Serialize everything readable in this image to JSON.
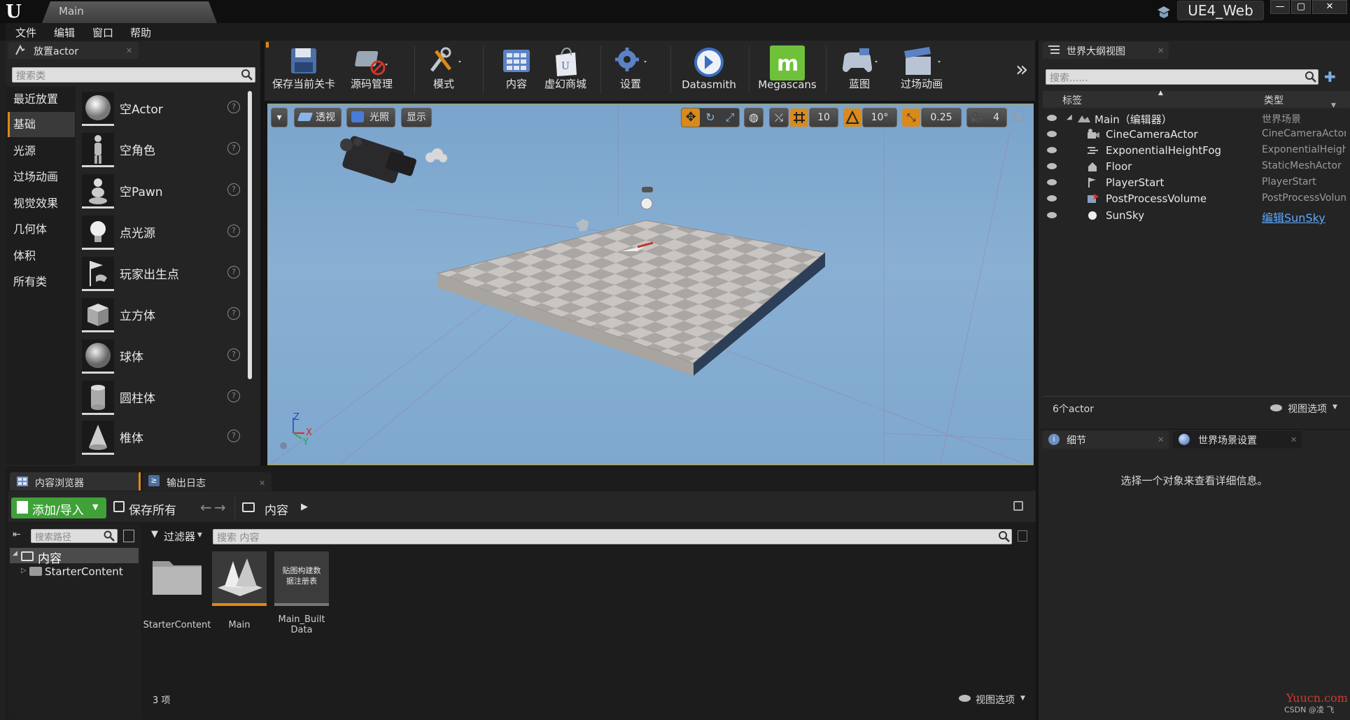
{
  "window": {
    "doc_tab": "Main",
    "project_name": "UE4_Web",
    "controls": [
      "—",
      "▢",
      "✕"
    ]
  },
  "menu": [
    "文件",
    "编辑",
    "窗口",
    "帮助"
  ],
  "place_actors": {
    "tab_title": "放置actor",
    "search_placeholder": "搜索类",
    "categories": [
      "最近放置",
      "基础",
      "光源",
      "过场动画",
      "视觉效果",
      "几何体",
      "体积",
      "所有类"
    ],
    "selected_category": "基础",
    "items": [
      "空Actor",
      "空角色",
      "空Pawn",
      "点光源",
      "玩家出生点",
      "立方体",
      "球体",
      "圆柱体",
      "椎体"
    ],
    "help_glyph": "?"
  },
  "toolbar": {
    "buttons": [
      "保存当前关卡",
      "源码管理",
      "模式",
      "内容",
      "虚幻商城",
      "设置",
      "Datasmith",
      "Megascans",
      "蓝图",
      "过场动画"
    ],
    "overflow": "»",
    "megascans_color": "#6fc13a"
  },
  "viewport": {
    "view_mode": "透视",
    "lighting": "光照",
    "show": "显示",
    "grid_snap": "10",
    "rotation_snap": "10°",
    "scale_snap": "0.25",
    "camera_speed": "4",
    "axis": {
      "z": "Z",
      "x": "X",
      "y": "Y"
    },
    "highlight_color": "#d98a1a"
  },
  "outliner": {
    "tab_title": "世界大纲视图",
    "search_placeholder": "搜索......",
    "col_label": "标签",
    "col_type": "类型",
    "root": {
      "name": "Main（编辑器）",
      "type": "世界场景"
    },
    "rows": [
      {
        "name": "CineCameraActor",
        "type": "CineCameraActor"
      },
      {
        "name": "ExponentialHeightFog",
        "type": "ExponentialHeightFog"
      },
      {
        "name": "Floor",
        "type": "StaticMeshActor"
      },
      {
        "name": "PlayerStart",
        "type": "PlayerStart"
      },
      {
        "name": "PostProcessVolume",
        "type": "PostProcessVolume"
      },
      {
        "name": "SunSky",
        "type": "编辑SunSky"
      }
    ],
    "count": "6个actor",
    "view_options": "视图选项"
  },
  "details": {
    "tab_details": "细节",
    "tab_world": "世界场景设置",
    "empty_message": "选择一个对象来查看详细信息。"
  },
  "content_browser": {
    "tab_title": "内容浏览器",
    "tab_log": "输出日志",
    "add_import": "添加/导入",
    "save_all": "保存所有",
    "path_root": "内容",
    "search_paths_placeholder": "搜索路径",
    "filters": "过滤器",
    "search_content_placeholder": "搜索 内容",
    "tree": [
      "内容",
      "StarterContent"
    ],
    "assets": [
      {
        "name": "StarterContent",
        "kind": "folder"
      },
      {
        "name": "Main",
        "kind": "level"
      },
      {
        "name": "Main_Built\nData",
        "kind": "map_build_data",
        "thumb_text": "贴图构建数\n据注册表"
      }
    ],
    "count": "3 项",
    "view_options": "视图选项"
  },
  "watermarks": {
    "site": "Yuucn.com",
    "author": "CSDN @凌 飞"
  }
}
